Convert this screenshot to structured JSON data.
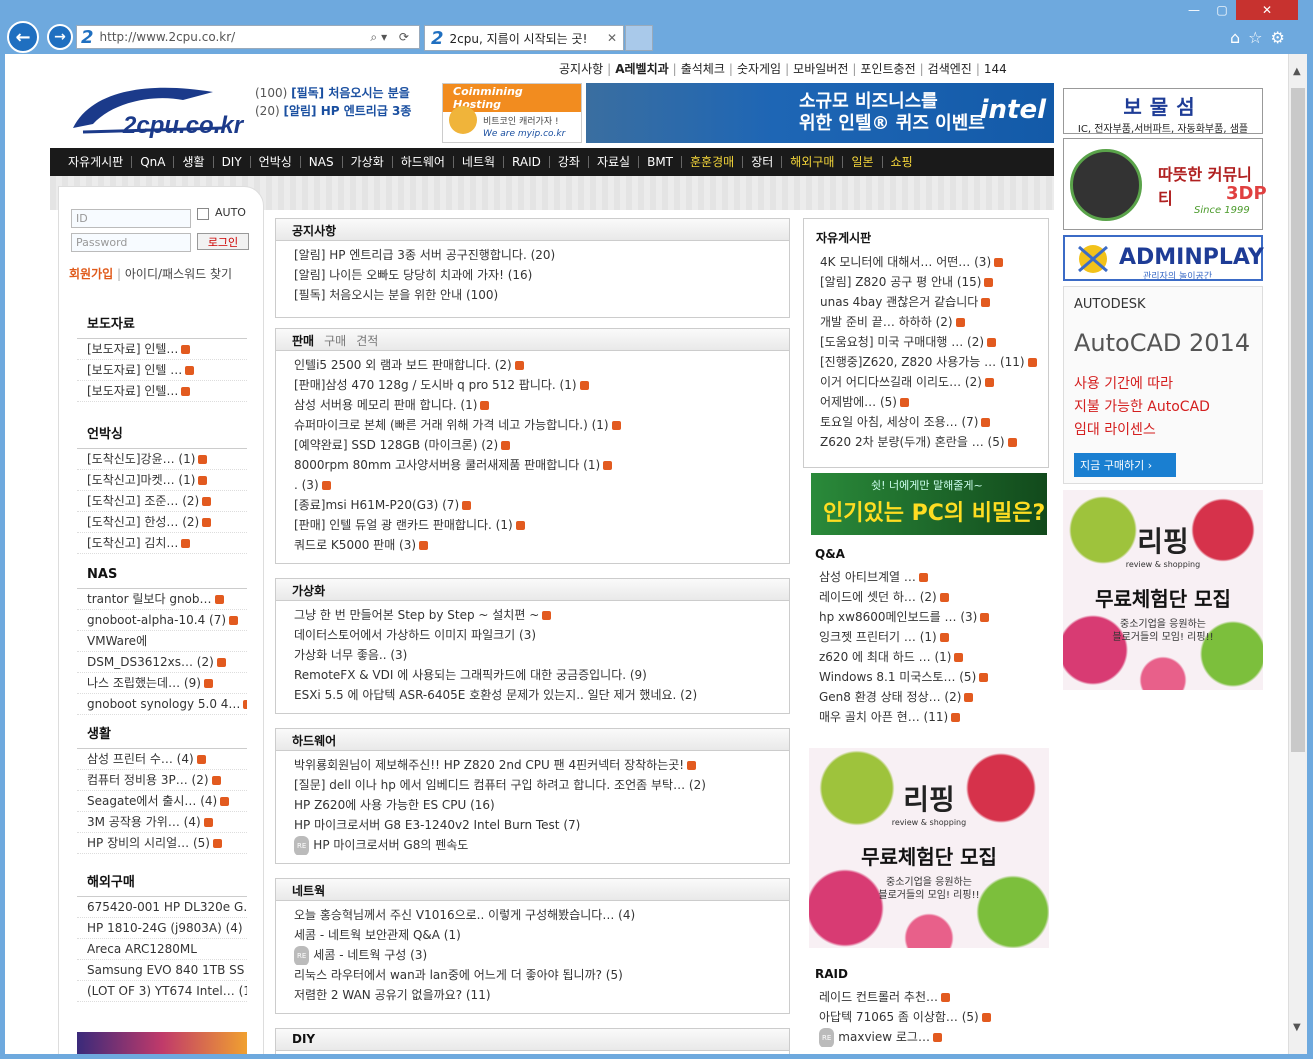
{
  "browser": {
    "url": "http://www.2cpu.co.kr/",
    "tab_title": "2cpu, 지름이 시작되는 곳!"
  },
  "toplinks": [
    "공지사항",
    "A레벨치과",
    "출석체크",
    "숫자게임",
    "모바일버전",
    "포인트충전",
    "검색엔진",
    "144"
  ],
  "logo_text": "2cpu.co.kr",
  "mini_notices": [
    {
      "count": "(100)",
      "title": "[필독] 처음오시는 분을"
    },
    {
      "count": "(20)",
      "title": "[알림] HP 엔트리급 3종"
    }
  ],
  "ads": {
    "coin": {
      "head": "Coinmining Hosting",
      "line1": "비트코인 캐러가자 !",
      "line2": "We are myip.co.kr"
    },
    "intel": {
      "line1": "소규모 비즈니스를",
      "line2": "위한 인텔® 퀴즈 이벤트",
      "brand": "intel"
    },
    "bomul": {
      "title": "보물섬",
      "sub": "IC, 전자부품,서버파트, 자동화부품, 샘플"
    },
    "dp3": {
      "t1": "따뜻한 커뮤니티",
      "t2": "3DP",
      "t3": "Since 1999"
    },
    "admin": {
      "title": "ADMINPLAY",
      "sub": "관리자의 놀이공간"
    },
    "autodesk": {
      "brand": "AUTODESK",
      "title": "AutoCAD 2014",
      "l1": "사용 기간에 따라",
      "l2": "지불 가능한 AutoCAD",
      "l3": "임대 라이센스",
      "btn": "지금 구매하기  ›"
    },
    "ripping": {
      "logo": "리핑",
      "sub": "review & shopping",
      "main": "무료체험단 모집",
      "desc1": "중소기업을 응원하는",
      "desc2": "블로거들의 모임! 리핑!!"
    },
    "pc": {
      "small": "쉿! 너에게만 말해줄게~",
      "main": "인기있는 PC의 비밀은?"
    }
  },
  "menu": [
    {
      "t": "자유게시판",
      "y": false
    },
    {
      "t": "QnA",
      "y": false
    },
    {
      "t": "생활",
      "y": false
    },
    {
      "t": "DIY",
      "y": false
    },
    {
      "t": "언박싱",
      "y": false
    },
    {
      "t": "NAS",
      "y": false
    },
    {
      "t": "가상화",
      "y": false
    },
    {
      "t": "하드웨어",
      "y": false
    },
    {
      "t": "네트웍",
      "y": false
    },
    {
      "t": "RAID",
      "y": false
    },
    {
      "t": "강좌",
      "y": false
    },
    {
      "t": "자료실",
      "y": false
    },
    {
      "t": "BMT",
      "y": false
    },
    {
      "t": "훈훈경매",
      "y": true
    },
    {
      "t": "장터",
      "y": false
    },
    {
      "t": "해외구매",
      "y": true
    },
    {
      "t": "일본",
      "y": true
    },
    {
      "t": "쇼핑",
      "y": true
    }
  ],
  "login": {
    "id_ph": "ID",
    "pw_ph": "Password",
    "auto": "AUTO",
    "btn": "로그인",
    "join": "회원가입",
    "find": "아이디/패스워드 찾기"
  },
  "sidebar": [
    {
      "title": "보도자료",
      "items": [
        "[보도자료] 인텔…",
        "[보도자료] 인텔 …",
        "[보도자료] 인텔…"
      ]
    },
    {
      "title": "언박싱",
      "items": [
        "[도착신도]강윤… (1)",
        "[도착신고]마켓… (1)",
        "[도착신고] 조준… (2)",
        "[도착신고] 한성… (2)",
        "[도착신고] 김치…"
      ]
    },
    {
      "title": "NAS",
      "items": [
        "trantor 릴보다 gnob…",
        "gnoboot-alpha-10.4 (7)",
        "VMWare에",
        "DSM_DS3612xs… (2)",
        "나스 조립했는데… (9)",
        "gnoboot synology 5.0 4…"
      ]
    },
    {
      "title": "생활",
      "items": [
        "삼성 프린터 수… (4)",
        "컴퓨터 정비용 3P… (2)",
        "Seagate에서 출시… (4)",
        "3M 공작용 가위… (4)",
        "HP 장비의 시리얼… (5)"
      ]
    },
    {
      "title": "해외구매",
      "items": [
        "675420-001 HP DL320e G…",
        "HP 1810-24G (j9803A) (4)",
        "Areca ARC1280ML",
        "Samsung EVO 840 1TB SS",
        "(LOT OF 3) YT674 Intel… (1)"
      ]
    }
  ],
  "panels": [
    {
      "title": "공지사항",
      "tabs": [],
      "rows": [
        "[알림] HP 엔트리급 3종 서버 공구진행합니다. (20)",
        "[알림] 나이든 오빠도 당당히 치과에 가자! (16)",
        "[필독] 처음오시는 분을 위한 안내 (100)"
      ]
    },
    {
      "title": "판매",
      "tabs": [
        "구매",
        "견적"
      ],
      "rows": [
        "인텔i5 2500 외 램과 보드 판매합니다. (2)",
        "[판매]삼성 470 128g / 도시바 q pro 512 팝니다. (1)",
        "삼성 서버용 메모리 판매 합니다. (1)",
        "슈퍼마이크로 본체 (빠른 거래 위해 가격 네고 가능합니다.) (1)",
        "[예약완료] SSD 128GB (마이크론) (2)",
        "8000rpm 80mm 고사양서버용 쿨러새제품 판매합니다 (1)",
        ". (3)",
        "[종료]msi H61M-P20(G3) (7)",
        "[판매] 인텔 듀얼 광 랜카드 판매합니다. (1)",
        "쿼드로 K5000 판매 (3)"
      ]
    },
    {
      "title": "가상화",
      "tabs": [],
      "rows": [
        "그냥 한 번 만들어본 Step by Step ~ 설치편 ~",
        "데이터스토어에서 가상하드 이미지 파일크기 (3)",
        "가상화 너무 좋음.. (3)",
        "RemoteFX & VDI 에 사용되는 그래픽카드에 대한 궁금증입니다. (9)",
        "ESXi 5.5 에 아답텍 ASR-6405E 호환성 문제가 있는지.. 일단 제거 했네요. (2)"
      ]
    },
    {
      "title": "하드웨어",
      "tabs": [],
      "rows": [
        "박위룡회원님이 제보해주신!! HP Z820 2nd CPU 팬 4핀커넥터 장착하는곳!",
        "[질문] dell 이나 hp 에서 임베디드 컴퓨터 구입 하려고 합니다. 조언좀 부탁… (2)",
        "HP Z620에 사용 가능한 ES CPU (16)",
        "HP 마이크로서버 G8 E3-1240v2 Intel Burn Test (7)",
        "HP 마이크로서버 G8의 펜속도"
      ]
    },
    {
      "title": "네트웍",
      "tabs": [],
      "rows": [
        "오늘 홍승혁님께서 주신 V1016으로.. 이렇게 구성해봤습니다… (4)",
        "세콤 - 네트웍 보안관제 Q&A (1)",
        "세콤 - 네트웍 구성 (3)",
        "리눅스 라우터에서 wan과 lan중에 어느게 더 좋아야 됩니까? (5)",
        "저렴한 2 WAN 공유기 없을까요? (11)"
      ]
    },
    {
      "title": "DIY",
      "tabs": [],
      "rows": []
    }
  ],
  "right": [
    {
      "title": "자유게시판",
      "items": [
        "4K 모니터에 대해서… 어떤… (3)",
        "[알림] Z820 공구 평 안내 (15)",
        "unas 4bay 괜찮은거 같습니다",
        "개발 준비 끝… 하하하 (2)",
        "[도움요청] 미국 구매대행 … (2)",
        "[진행중]Z620, Z820 사용가능 … (11)",
        "이거 어디다쓰길래 이리도… (2)",
        "어제밤에… (5)",
        "토요일 아침, 세상이 조용… (7)",
        "Z620 2차 분량(두개) 혼란을 … (5)"
      ]
    },
    {
      "title": "Q&A",
      "items": [
        "삼성 아티브계열 …",
        "레이드에 셋던 하… (2)",
        "hp xw8600메인보드를 … (3)",
        "잉크젯 프린터기 … (1)",
        "z620 에 최대 하드 … (1)",
        "Windows 8.1 미국스토… (5)",
        "Gen8 환경 상태 정상… (2)",
        "매우 골치 아픈 현… (11)"
      ]
    },
    {
      "title": "RAID",
      "items": [
        "레이드 컨트롤러 추천…",
        "아답텍 71065 좀 이상함… (5)",
        "maxview 로그…"
      ]
    }
  ]
}
